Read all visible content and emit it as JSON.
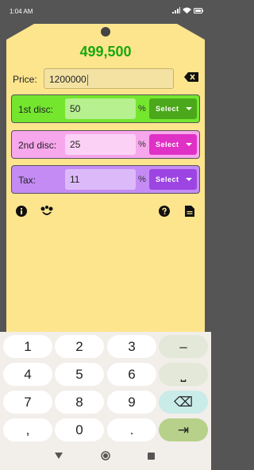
{
  "status": {
    "time": "1:04 AM"
  },
  "calc": {
    "result": "499,500",
    "price_label": "Price:",
    "price_value": "1200000"
  },
  "rows": [
    {
      "label": "1st disc:",
      "value": "50",
      "unit": "%",
      "select": "Select",
      "color": "#74e62e"
    },
    {
      "label": "2nd disc:",
      "value": "25",
      "unit": "%",
      "select": "Select",
      "color": "#f7a7ec"
    },
    {
      "label": "Tax:",
      "value": "11",
      "unit": "%",
      "select": "Select",
      "color": "#c48bf5"
    }
  ],
  "keyboard": {
    "keys": [
      "1",
      "2",
      "3",
      "–",
      "4",
      "5",
      "6",
      "⎵",
      "7",
      "8",
      "9",
      "⌫",
      ",",
      "0",
      ".",
      "⇥"
    ]
  },
  "icons": [
    "info-icon",
    "share-icon",
    "help-icon",
    "document-icon",
    "backspace-icon",
    "wifi-icon",
    "signal-icon",
    "battery-icon"
  ]
}
